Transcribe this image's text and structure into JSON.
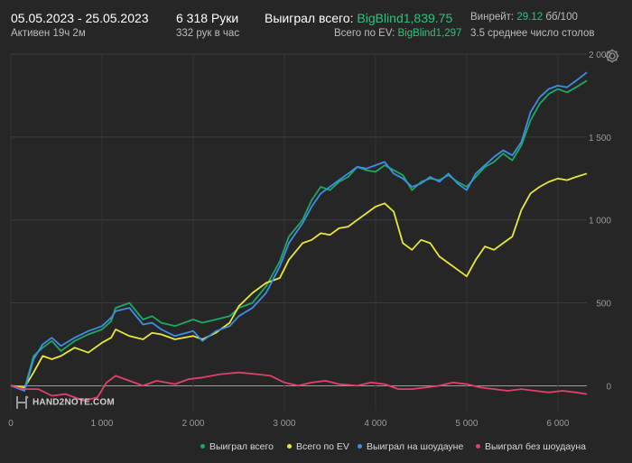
{
  "header": {
    "date_range": "05.05.2023 - 25.05.2023",
    "active": "Активен 19ч 2м",
    "hands": "6 318 Руки",
    "hands_rate": "332 рук в час",
    "won_label": "Выиграл всего:",
    "won_value": "BigBlind1,839.75",
    "ev_label": "Всего по EV:",
    "ev_value": "BigBlind1,297",
    "winrate_label": "Винрейт:",
    "winrate_value": "29.12",
    "winrate_unit": "бб/100",
    "tables": "3.5 среднее число столов"
  },
  "logo": {
    "text": "HAND2NOTE.COM"
  },
  "icons": {
    "settings": "gear-icon",
    "logo": "hand2note-logo-icon"
  },
  "chart_data": {
    "type": "line",
    "xlim": [
      0,
      6318
    ],
    "ylim": [
      -150,
      2000
    ],
    "x_ticks": [
      0,
      1000,
      2000,
      3000,
      4000,
      5000,
      6000
    ],
    "x_tick_labels": [
      "0",
      "1 000",
      "2 000",
      "3 000",
      "4 000",
      "5 000",
      "6 000"
    ],
    "y_ticks": [
      0,
      500,
      1000,
      1500,
      2000
    ],
    "y_tick_labels": [
      "0",
      "500",
      "1 000",
      "1 500",
      "2 000"
    ],
    "grid": true,
    "legend_position": "bottom",
    "series": [
      {
        "name": "Выиграл всего",
        "color": "#1fa865",
        "points": [
          [
            0,
            0
          ],
          [
            150,
            -20
          ],
          [
            250,
            180
          ],
          [
            350,
            230
          ],
          [
            450,
            270
          ],
          [
            550,
            210
          ],
          [
            700,
            270
          ],
          [
            850,
            310
          ],
          [
            1000,
            340
          ],
          [
            1100,
            390
          ],
          [
            1150,
            470
          ],
          [
            1300,
            500
          ],
          [
            1450,
            400
          ],
          [
            1550,
            420
          ],
          [
            1650,
            380
          ],
          [
            1800,
            360
          ],
          [
            2000,
            400
          ],
          [
            2100,
            380
          ],
          [
            2250,
            400
          ],
          [
            2400,
            420
          ],
          [
            2500,
            470
          ],
          [
            2650,
            500
          ],
          [
            2800,
            600
          ],
          [
            2950,
            750
          ],
          [
            3050,
            900
          ],
          [
            3200,
            1000
          ],
          [
            3300,
            1120
          ],
          [
            3400,
            1200
          ],
          [
            3500,
            1180
          ],
          [
            3600,
            1230
          ],
          [
            3700,
            1260
          ],
          [
            3800,
            1320
          ],
          [
            3900,
            1300
          ],
          [
            4000,
            1290
          ],
          [
            4100,
            1330
          ],
          [
            4200,
            1300
          ],
          [
            4300,
            1270
          ],
          [
            4400,
            1180
          ],
          [
            4500,
            1230
          ],
          [
            4600,
            1250
          ],
          [
            4700,
            1240
          ],
          [
            4800,
            1270
          ],
          [
            4900,
            1230
          ],
          [
            5000,
            1200
          ],
          [
            5100,
            1260
          ],
          [
            5200,
            1320
          ],
          [
            5300,
            1350
          ],
          [
            5400,
            1400
          ],
          [
            5500,
            1360
          ],
          [
            5600,
            1450
          ],
          [
            5700,
            1600
          ],
          [
            5800,
            1700
          ],
          [
            5900,
            1760
          ],
          [
            6000,
            1790
          ],
          [
            6100,
            1770
          ],
          [
            6200,
            1800
          ],
          [
            6318,
            1840
          ]
        ]
      },
      {
        "name": "Всего по EV",
        "color": "#e8e83a",
        "points": [
          [
            0,
            0
          ],
          [
            150,
            -10
          ],
          [
            250,
            80
          ],
          [
            350,
            180
          ],
          [
            450,
            160
          ],
          [
            550,
            180
          ],
          [
            700,
            230
          ],
          [
            850,
            200
          ],
          [
            1000,
            260
          ],
          [
            1100,
            290
          ],
          [
            1150,
            340
          ],
          [
            1300,
            300
          ],
          [
            1450,
            280
          ],
          [
            1550,
            320
          ],
          [
            1650,
            310
          ],
          [
            1800,
            280
          ],
          [
            2000,
            300
          ],
          [
            2100,
            280
          ],
          [
            2250,
            320
          ],
          [
            2400,
            380
          ],
          [
            2500,
            480
          ],
          [
            2650,
            560
          ],
          [
            2800,
            620
          ],
          [
            2950,
            650
          ],
          [
            3050,
            760
          ],
          [
            3200,
            860
          ],
          [
            3300,
            880
          ],
          [
            3400,
            920
          ],
          [
            3500,
            910
          ],
          [
            3600,
            950
          ],
          [
            3700,
            960
          ],
          [
            3800,
            1000
          ],
          [
            3900,
            1040
          ],
          [
            4000,
            1080
          ],
          [
            4100,
            1100
          ],
          [
            4200,
            1050
          ],
          [
            4300,
            860
          ],
          [
            4400,
            820
          ],
          [
            4500,
            880
          ],
          [
            4600,
            860
          ],
          [
            4700,
            780
          ],
          [
            4800,
            740
          ],
          [
            4900,
            700
          ],
          [
            5000,
            660
          ],
          [
            5100,
            760
          ],
          [
            5200,
            840
          ],
          [
            5300,
            820
          ],
          [
            5400,
            860
          ],
          [
            5500,
            900
          ],
          [
            5600,
            1060
          ],
          [
            5700,
            1160
          ],
          [
            5800,
            1200
          ],
          [
            5900,
            1230
          ],
          [
            6000,
            1250
          ],
          [
            6100,
            1240
          ],
          [
            6200,
            1260
          ],
          [
            6318,
            1280
          ]
        ]
      },
      {
        "name": "Выиграл на шоудауне",
        "color": "#3e8ee6",
        "points": [
          [
            0,
            0
          ],
          [
            150,
            -30
          ],
          [
            250,
            160
          ],
          [
            350,
            250
          ],
          [
            450,
            290
          ],
          [
            550,
            240
          ],
          [
            700,
            290
          ],
          [
            850,
            330
          ],
          [
            1000,
            360
          ],
          [
            1100,
            410
          ],
          [
            1150,
            450
          ],
          [
            1300,
            470
          ],
          [
            1450,
            370
          ],
          [
            1550,
            380
          ],
          [
            1650,
            340
          ],
          [
            1800,
            300
          ],
          [
            2000,
            330
          ],
          [
            2100,
            270
          ],
          [
            2250,
            330
          ],
          [
            2400,
            360
          ],
          [
            2500,
            420
          ],
          [
            2650,
            470
          ],
          [
            2800,
            560
          ],
          [
            2950,
            720
          ],
          [
            3050,
            860
          ],
          [
            3200,
            980
          ],
          [
            3300,
            1080
          ],
          [
            3400,
            1160
          ],
          [
            3500,
            1200
          ],
          [
            3600,
            1240
          ],
          [
            3700,
            1280
          ],
          [
            3800,
            1320
          ],
          [
            3900,
            1310
          ],
          [
            4000,
            1330
          ],
          [
            4100,
            1350
          ],
          [
            4200,
            1280
          ],
          [
            4300,
            1250
          ],
          [
            4400,
            1200
          ],
          [
            4500,
            1220
          ],
          [
            4600,
            1260
          ],
          [
            4700,
            1230
          ],
          [
            4800,
            1280
          ],
          [
            4900,
            1220
          ],
          [
            5000,
            1180
          ],
          [
            5100,
            1280
          ],
          [
            5200,
            1330
          ],
          [
            5300,
            1380
          ],
          [
            5400,
            1420
          ],
          [
            5500,
            1390
          ],
          [
            5600,
            1470
          ],
          [
            5700,
            1650
          ],
          [
            5800,
            1740
          ],
          [
            5900,
            1790
          ],
          [
            6000,
            1810
          ],
          [
            6100,
            1800
          ],
          [
            6200,
            1840
          ],
          [
            6318,
            1890
          ]
        ]
      },
      {
        "name": "Выиграл без шоудауна",
        "color": "#e0406a",
        "points": [
          [
            0,
            0
          ],
          [
            150,
            -20
          ],
          [
            300,
            -20
          ],
          [
            450,
            -60
          ],
          [
            600,
            -50
          ],
          [
            800,
            -90
          ],
          [
            950,
            -70
          ],
          [
            1050,
            20
          ],
          [
            1150,
            60
          ],
          [
            1300,
            30
          ],
          [
            1450,
            0
          ],
          [
            1600,
            30
          ],
          [
            1800,
            10
          ],
          [
            1950,
            40
          ],
          [
            2100,
            50
          ],
          [
            2300,
            70
          ],
          [
            2500,
            80
          ],
          [
            2700,
            70
          ],
          [
            2850,
            60
          ],
          [
            3000,
            20
          ],
          [
            3150,
            0
          ],
          [
            3300,
            20
          ],
          [
            3450,
            30
          ],
          [
            3600,
            10
          ],
          [
            3800,
            0
          ],
          [
            3950,
            20
          ],
          [
            4100,
            10
          ],
          [
            4250,
            -20
          ],
          [
            4400,
            -20
          ],
          [
            4550,
            -10
          ],
          [
            4700,
            0
          ],
          [
            4850,
            20
          ],
          [
            5000,
            10
          ],
          [
            5150,
            -10
          ],
          [
            5300,
            -20
          ],
          [
            5450,
            -30
          ],
          [
            5600,
            -20
          ],
          [
            5750,
            -30
          ],
          [
            5900,
            -40
          ],
          [
            6050,
            -30
          ],
          [
            6200,
            -40
          ],
          [
            6318,
            -50
          ]
        ]
      }
    ]
  }
}
